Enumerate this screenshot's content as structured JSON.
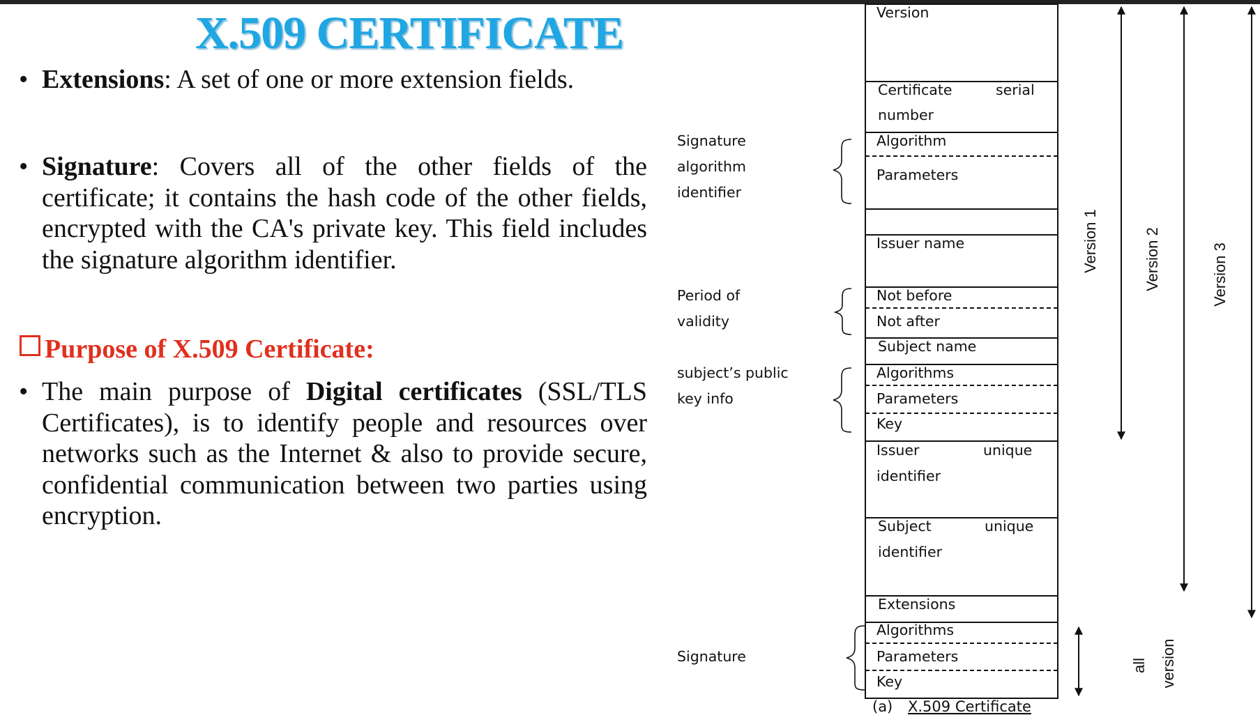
{
  "title": "X.509 CERTIFICATE",
  "extensions": {
    "term": "Extensions",
    "text": ": A set of one or more extension fields."
  },
  "signature": {
    "term": "Signature",
    "text": ": Covers all of the other fields of the certificate; it contains the hash code of the other fields, encrypted with the CA's private key. This field includes the signature algorithm identifier."
  },
  "purpose_heading": "Purpose of X.509 Certificate:",
  "purpose": {
    "pre": "The main purpose of ",
    "term": "Digital certificates",
    "post": " (SSL/TLS Certificates), is to identify people and resources over networks such as the Internet & also to provide secure, confidential communication between two parties using encryption."
  },
  "diagram": {
    "fields": {
      "version": "Version",
      "serial_1": "Certificate",
      "serial_2": "serial",
      "serial_3": "number",
      "sig_algorithm": "Algorithm",
      "sig_parameters": "Parameters",
      "issuer_name": "Issuer name",
      "not_before": "Not before",
      "not_after": "Not after",
      "subject_name": "Subject name",
      "pk_algorithms": "Algorithms",
      "pk_parameters": "Parameters",
      "pk_key": "Key",
      "issuer_uid_1": "Issuer",
      "issuer_uid_2": "unique",
      "issuer_uid_3": "identifier",
      "subject_uid_1": "Subject",
      "subject_uid_2": "unique",
      "subject_uid_3": "identifier",
      "extensions": "Extensions",
      "s_algorithms": "Algorithms",
      "s_parameters": "Parameters",
      "s_key": "Key"
    },
    "groups": {
      "sig_alg_1": "Signature",
      "sig_alg_2": "algorithm",
      "sig_alg_3": "identifier",
      "validity_1": "Period of",
      "validity_2": "validity",
      "pubkey_1": "subject’s public",
      "pubkey_2": "key info",
      "signature": "Signature"
    },
    "versions": {
      "v1": "Version 1",
      "v2": "Version 2",
      "v3": "Version 3",
      "all": "all",
      "version": "version"
    },
    "caption_prefix": "(a) ",
    "caption": "X.509 Certificate"
  }
}
